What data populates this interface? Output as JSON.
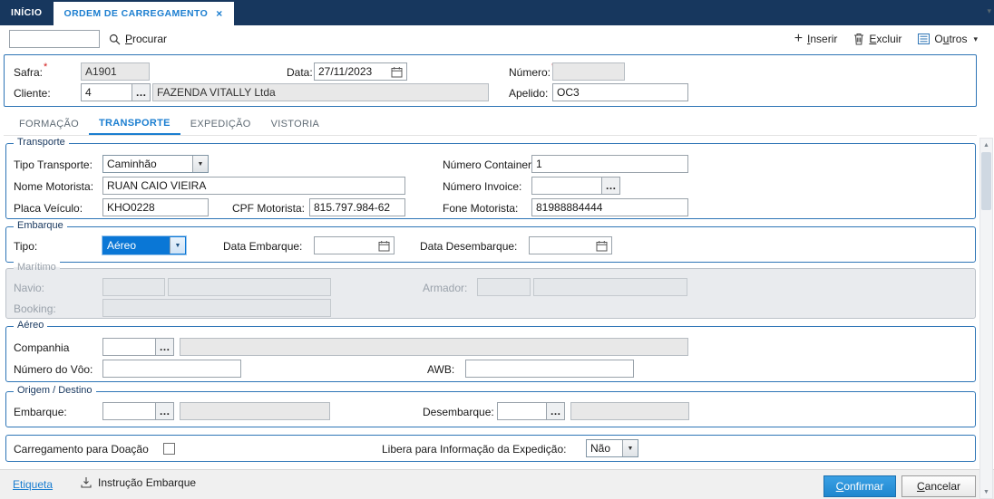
{
  "icons": {
    "close": "×",
    "plus": "+",
    "caret_down": "▾",
    "arrow_down": "▼",
    "arrow_up": "▲",
    "ellipsis": "…",
    "required": "*"
  },
  "window_tabs": {
    "inicio": "INÍCIO",
    "active": "ORDEM DE CARREGAMENTO"
  },
  "toolbar": {
    "search_value": "",
    "procurar": {
      "pre": "",
      "key": "P",
      "rest": "rocurar"
    },
    "inserir": {
      "pre": "",
      "key": "I",
      "rest": "nserir"
    },
    "excluir": {
      "pre": "",
      "key": "E",
      "rest": "xcluir"
    },
    "outros": {
      "pre": "O",
      "key": "u",
      "rest": "tros"
    }
  },
  "header": {
    "safra_label": "Safra:",
    "safra_value": "A1901",
    "data_label": "Data:",
    "data_value": "27/11/2023",
    "numero_label": "Número:",
    "numero_value": "",
    "cliente_label": "Cliente:",
    "cliente_code": "4",
    "cliente_name": "FAZENDA VITALLY Ltda",
    "apelido_label": "Apelido:",
    "apelido_value": "OC3"
  },
  "page_tabs": {
    "formacao": "FORMAÇÃO",
    "transporte": "TRANSPORTE",
    "expedicao": "EXPEDIÇÃO",
    "vistoria": "VISTORIA"
  },
  "transporte": {
    "legend": "Transporte",
    "tipo_label": "Tipo Transporte:",
    "tipo_value": "Caminhão",
    "container_label": "Número Container:",
    "container_value": "1",
    "motorista_label": "Nome Motorista:",
    "motorista_value": "RUAN CAIO VIEIRA",
    "invoice_label": "Número Invoice:",
    "invoice_value": "",
    "placa_label": "Placa Veículo:",
    "placa_value": "KHO0228",
    "cpf_label": "CPF Motorista:",
    "cpf_value": "815.797.984-62",
    "fone_label": "Fone Motorista:",
    "fone_value": "81988884444"
  },
  "embarque": {
    "legend": "Embarque",
    "tipo_label": "Tipo:",
    "tipo_value": "Aéreo",
    "data_embarque_label": "Data Embarque:",
    "data_embarque_value": "",
    "data_desembarque_label": "Data Desembarque:",
    "data_desembarque_value": ""
  },
  "maritimo": {
    "legend": "Marítimo",
    "navio_label": "Navio:",
    "navio_code": "",
    "navio_name": "",
    "armador_label": "Armador:",
    "armador_code": "",
    "armador_name": "",
    "booking_label": "Booking:",
    "booking_value": ""
  },
  "aereo": {
    "legend": "Aéreo",
    "companhia_label": "Companhia",
    "companhia_code": "",
    "companhia_name": "",
    "voo_label": "Número do Vôo:",
    "voo_value": "",
    "awb_label": "AWB:",
    "awb_value": ""
  },
  "origem_destino": {
    "legend": "Origem / Destino",
    "embarque_label": "Embarque:",
    "embarque_code": "",
    "embarque_name": "",
    "desembarque_label": "Desembarque:",
    "desembarque_code": "",
    "desembarque_name": ""
  },
  "options": {
    "doacao_label": "Carregamento para Doação",
    "libera_label": "Libera para Informação da Expedição:",
    "libera_value": "Não"
  },
  "footer": {
    "etiqueta": "Etiqueta",
    "instrucao": "Instrução Embarque",
    "confirmar": {
      "pre": "",
      "key": "C",
      "rest": "onfirmar"
    },
    "cancelar": {
      "pre": "",
      "key": "C",
      "rest": "ancelar"
    }
  },
  "colors": {
    "titlebar": "#17375e",
    "accent_blue": "#2e75b6",
    "tab_active": "#1b7ed0",
    "selected_bg": "#0a77d6",
    "confirm_button": "#2493df",
    "required": "#d11a1a",
    "readonly_bg": "#e8e8e8",
    "disabled_bg": "#e9ebee"
  }
}
